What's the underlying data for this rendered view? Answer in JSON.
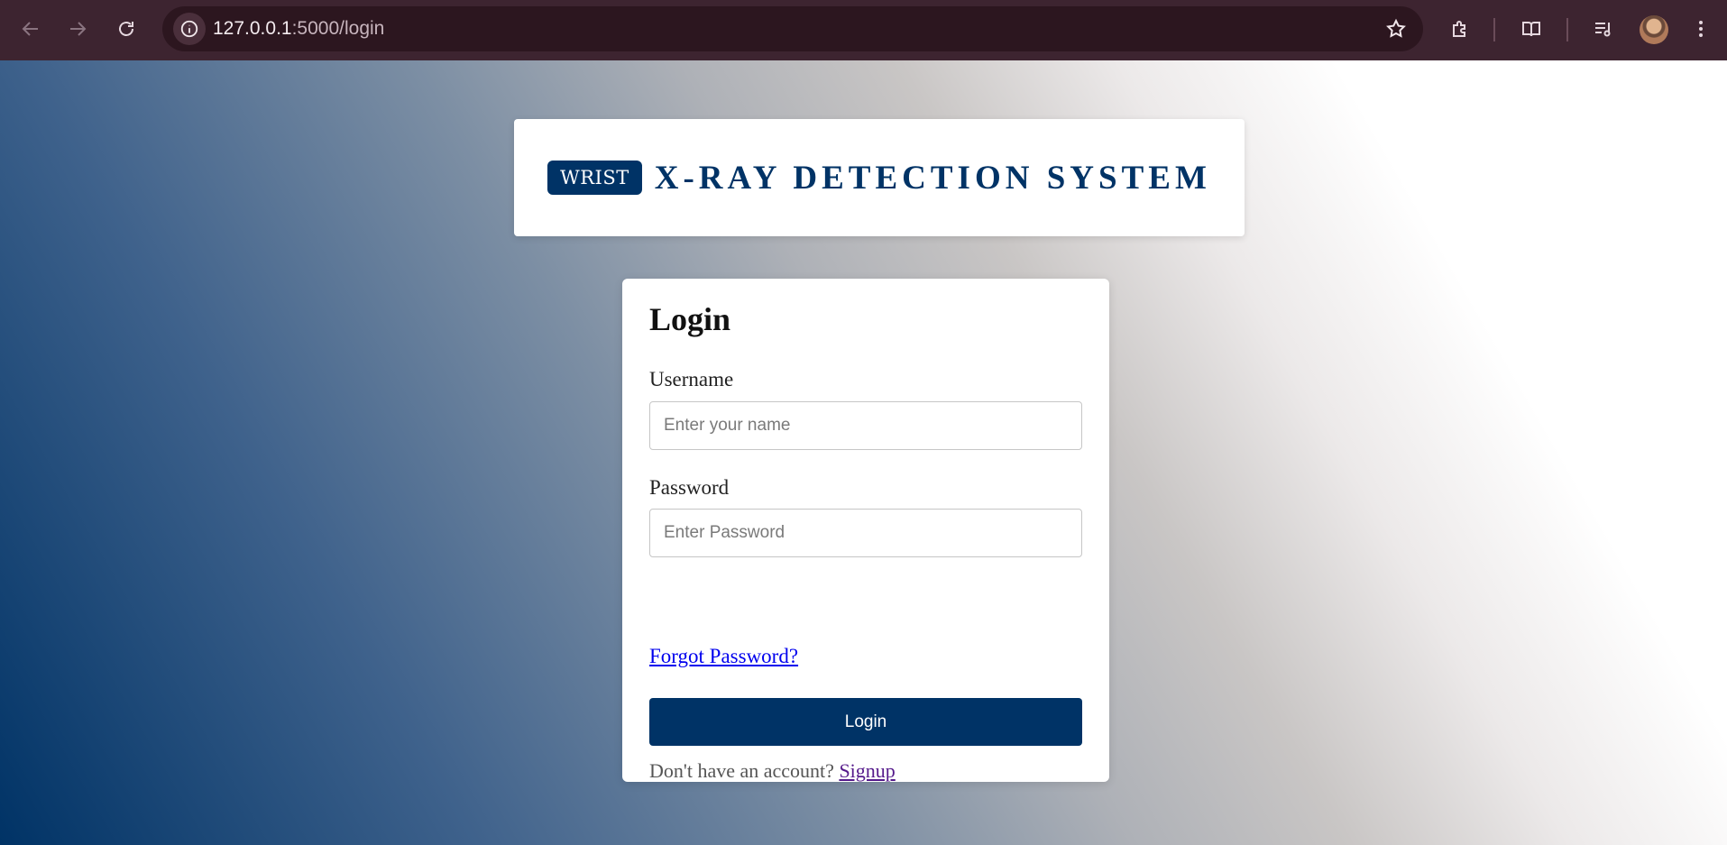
{
  "browser": {
    "url_host": "127.0.0.1",
    "url_path": ":5000/login",
    "icons": [
      "back-arrow-icon",
      "forward-arrow-icon",
      "reload-icon",
      "site-info-icon",
      "bookmark-star-icon",
      "extensions-icon",
      "reading-mode-icon",
      "media-controls-icon",
      "profile-avatar",
      "kebab-menu-icon"
    ]
  },
  "brand": {
    "badge": "WRIST",
    "title": "X-RAY DETECTION SYSTEM"
  },
  "login": {
    "title": "Login",
    "username_label": "Username",
    "username_placeholder": "Enter your name",
    "password_label": "Password",
    "password_placeholder": "Enter Password",
    "forgot_link": "Forgot Password?",
    "submit_label": "Login",
    "signup_prompt": "Don't have an account?",
    "signup_link": "Signup"
  },
  "colors": {
    "primary": "#003366",
    "link": "#0000ee",
    "visited_link": "#551a8b",
    "chrome_bg": "#3d2430"
  }
}
